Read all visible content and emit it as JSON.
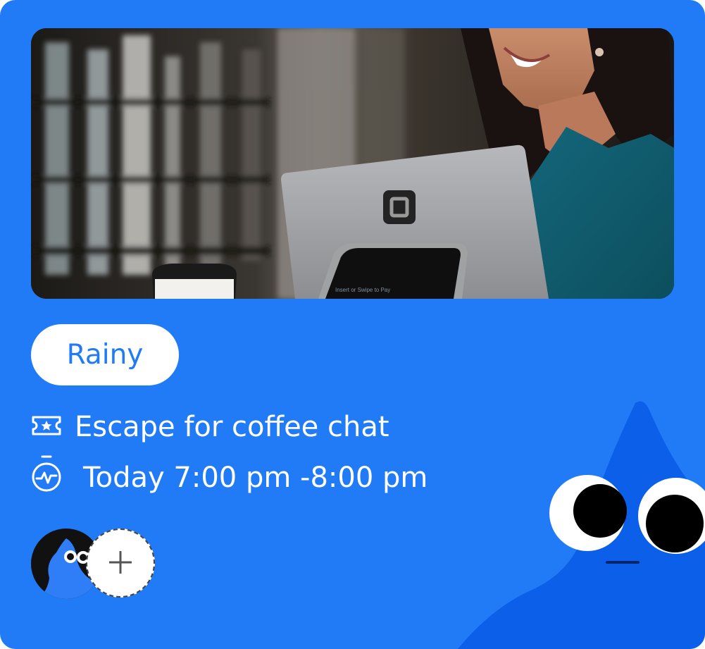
{
  "card": {
    "weather_label": "Rainy",
    "event_title": "Escape for coffee chat",
    "event_time": "Today 7:00 pm -8:00 pm",
    "photo_caption": "Insert or Swipe to Pay"
  },
  "icons": {
    "event": "ticket-icon",
    "time": "stopwatch-icon",
    "add": "plus-icon"
  },
  "colors": {
    "card_background": "#227bf6",
    "chip_background": "#ffffff",
    "chip_text": "#227bf6",
    "mascot_body": "#0b5fe8",
    "text": "#ffffff"
  }
}
